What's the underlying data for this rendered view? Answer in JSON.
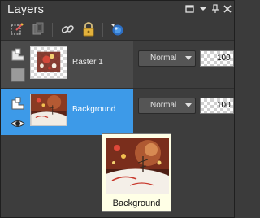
{
  "panel": {
    "title": "Layers",
    "controls": {
      "restore_icon": "restore-icon",
      "dropdown_icon": "chevron-down-icon",
      "pin_icon": "pin-icon",
      "close_icon": "close-icon"
    }
  },
  "toolbar": {
    "tools": [
      "edit-selection-icon",
      "mask-icon",
      "link-icon",
      "lock-icon",
      "shield-icon"
    ]
  },
  "layers": [
    {
      "name": "Raster 1",
      "blend_mode": "Normal",
      "opacity": "100",
      "selected": false
    },
    {
      "name": "Background",
      "blend_mode": "Normal",
      "opacity": "100",
      "selected": true
    }
  ],
  "tooltip": {
    "label": "Background"
  },
  "colors": {
    "selection": "#3d9ae8",
    "panel_bg": "#3d3d3d",
    "tooltip_bg": "#ffffe6"
  }
}
